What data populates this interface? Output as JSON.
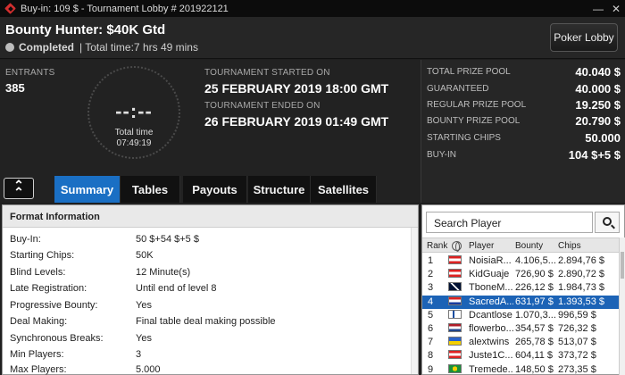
{
  "window": {
    "title": "Buy-in: 109 $ - Tournament Lobby # 201922121",
    "minimize": "—",
    "close": "✕"
  },
  "header": {
    "name": "Bounty Hunter: $40K Gtd",
    "status": "Completed",
    "total_time": "| Total time:7 hrs  49 mins",
    "lobby_button": "Poker Lobby"
  },
  "info": {
    "entrants_label": "ENTRANTS",
    "entrants": "385",
    "clock_digits": "--:--",
    "clock_label": "Total time",
    "clock_value": "07:49:19",
    "started_label": "TOURNAMENT STARTED ON",
    "started": "25 FEBRUARY 2019  18:00 GMT",
    "ended_label": "TOURNAMENT ENDED ON",
    "ended": "26 FEBRUARY 2019  01:49 GMT"
  },
  "prize": [
    {
      "label": "TOTAL PRIZE POOL",
      "value": "40.040 $"
    },
    {
      "label": "GUARANTEED",
      "value": "40.000 $"
    },
    {
      "label": "REGULAR PRIZE POOL",
      "value": "19.250 $"
    },
    {
      "label": "BOUNTY PRIZE POOL",
      "value": "20.790 $"
    },
    {
      "label": "STARTING CHIPS",
      "value": "50.000"
    },
    {
      "label": "BUY-IN",
      "value": "104 $+5 $"
    }
  ],
  "tabs": {
    "collapse": "ˆ",
    "items": [
      "Summary",
      "Tables",
      "Payouts",
      "Structure",
      "Satellites"
    ],
    "active": "Summary"
  },
  "format": {
    "heading": "Format Information",
    "rows": [
      {
        "k": "Buy-In:",
        "v": "50 $+54 $+5 $"
      },
      {
        "k": "Starting Chips:",
        "v": "50K"
      },
      {
        "k": "Blind Levels:",
        "v": "12 Minute(s)"
      },
      {
        "k": "Late Registration:",
        "v": "Until end of level 8"
      },
      {
        "k": "Progressive Bounty:",
        "v": "Yes"
      },
      {
        "k": "Deal Making:",
        "v": "Final table deal making possible"
      },
      {
        "k": "Synchronous Breaks:",
        "v": "Yes"
      },
      {
        "k": "Min Players:",
        "v": "3"
      },
      {
        "k": "Max Players:",
        "v": "5.000"
      }
    ]
  },
  "players": {
    "search_placeholder": "Search Player",
    "columns": [
      "Rank",
      "Player",
      "Bounty",
      "Chips"
    ],
    "selected_rank": 4,
    "rows": [
      {
        "rank": "1",
        "flag": "Austria",
        "player": "NoisiaR...",
        "bounty": "4.106,5...",
        "chips": "2.894,76 $"
      },
      {
        "rank": "2",
        "flag": "Austria",
        "player": "KidGuaje",
        "bounty": "726,90 $",
        "chips": "2.890,72 $"
      },
      {
        "rank": "3",
        "flag": "United Kingdom",
        "player": "TboneM...",
        "bounty": "226,12 $",
        "chips": "1.984,73 $"
      },
      {
        "rank": "4",
        "flag": "Croatia",
        "player": "SacredA...",
        "bounty": "631,97 $",
        "chips": "1.393,53 $"
      },
      {
        "rank": "5",
        "flag": "Finland",
        "player": "Dcantlose",
        "bounty": "1.070,3...",
        "chips": "996,59 $"
      },
      {
        "rank": "6",
        "flag": "Netherlands",
        "player": "flowerbo...",
        "bounty": "354,57 $",
        "chips": "726,32 $"
      },
      {
        "rank": "7",
        "flag": "Ukraine",
        "player": "alextwins",
        "bounty": "265,78 $",
        "chips": "513,07 $"
      },
      {
        "rank": "8",
        "flag": "Austria",
        "player": "Juste1C...",
        "bounty": "604,11 $",
        "chips": "373,72 $"
      },
      {
        "rank": "9",
        "flag": "Brazil",
        "player": "Tremede...",
        "bounty": "148,50 $",
        "chips": "273,35 $"
      }
    ]
  },
  "colors": {
    "accent": "#1a6fc4",
    "selected_row": "#1c63b6",
    "background": "#1f1f1f"
  }
}
